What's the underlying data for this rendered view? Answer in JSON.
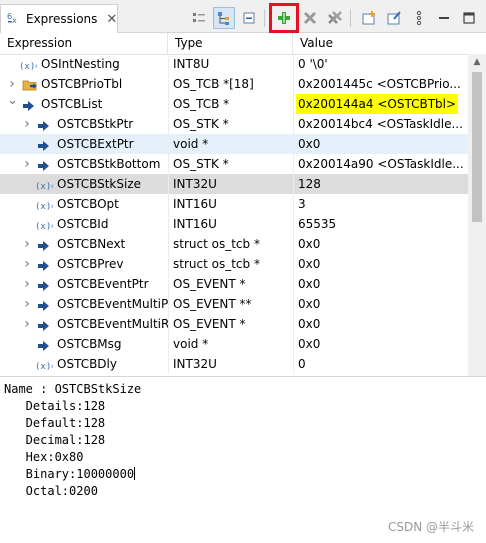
{
  "tab": {
    "title": "Expressions",
    "close": "✕"
  },
  "toolbar": {
    "buttons": [
      {
        "name": "show-type-names-icon"
      },
      {
        "name": "show-logical-structure-icon"
      },
      {
        "name": "collapse-all-icon"
      },
      {
        "name": "add-watch-expression-icon"
      },
      {
        "name": "remove-expression-icon"
      },
      {
        "name": "remove-all-expressions-icon"
      },
      {
        "name": "create-watch-expression-icon"
      },
      {
        "name": "edit-watch-expression-icon"
      },
      {
        "name": "view-menu-icon"
      },
      {
        "name": "minimize-icon"
      },
      {
        "name": "maximize-icon"
      }
    ]
  },
  "columns": {
    "expression": "Expression",
    "type": "Type",
    "value": "Value"
  },
  "rows": [
    {
      "name": "OSIntNesting",
      "type": "INT8U",
      "value": "0 '\\0'"
    },
    {
      "name": "OSTCBPrioTbl",
      "type": "OS_TCB *[18]",
      "value": "0x2001445c <OSTCBPrio..."
    },
    {
      "name": "OSTCBList",
      "type": "OS_TCB *",
      "value": "0x200144a4 <OSTCBTbl>"
    },
    {
      "name": "OSTCBStkPtr",
      "type": "OS_STK *",
      "value": "0x20014bc4 <OSTaskIdle..."
    },
    {
      "name": "OSTCBExtPtr",
      "type": "void *",
      "value": "0x0"
    },
    {
      "name": "OSTCBStkBottom",
      "type": "OS_STK *",
      "value": "0x20014a90 <OSTaskIdle..."
    },
    {
      "name": "OSTCBStkSize",
      "type": "INT32U",
      "value": "128"
    },
    {
      "name": "OSTCBOpt",
      "type": "INT16U",
      "value": "3"
    },
    {
      "name": "OSTCBId",
      "type": "INT16U",
      "value": "65535"
    },
    {
      "name": "OSTCBNext",
      "type": "struct os_tcb *",
      "value": "0x0"
    },
    {
      "name": "OSTCBPrev",
      "type": "struct os_tcb *",
      "value": "0x0"
    },
    {
      "name": "OSTCBEventPtr",
      "type": "OS_EVENT *",
      "value": "0x0"
    },
    {
      "name": "OSTCBEventMultiPt",
      "type": "OS_EVENT **",
      "value": "0x0"
    },
    {
      "name": "OSTCBEventMultiRe",
      "type": "OS_EVENT *",
      "value": "0x0"
    },
    {
      "name": "OSTCBMsg",
      "type": "void *",
      "value": "0x0"
    },
    {
      "name": "OSTCBDly",
      "type": "INT32U",
      "value": "0"
    }
  ],
  "details": {
    "name_line": "Name : OSTCBStkSize",
    "details_line": "   Details:128",
    "default_line": "   Default:128",
    "decimal_line": "   Decimal:128",
    "hex_line": "   Hex:0x80",
    "binary_line": "   Binary:10000000",
    "octal_line": "   Octal:0200"
  },
  "watermark": "CSDN @半斗米",
  "colors": {
    "highlight_value": "#ffff00",
    "toolbar_highlight": "#e81123",
    "selected_row": "#dcdcdc",
    "focused_row": "#e6f0fa"
  }
}
